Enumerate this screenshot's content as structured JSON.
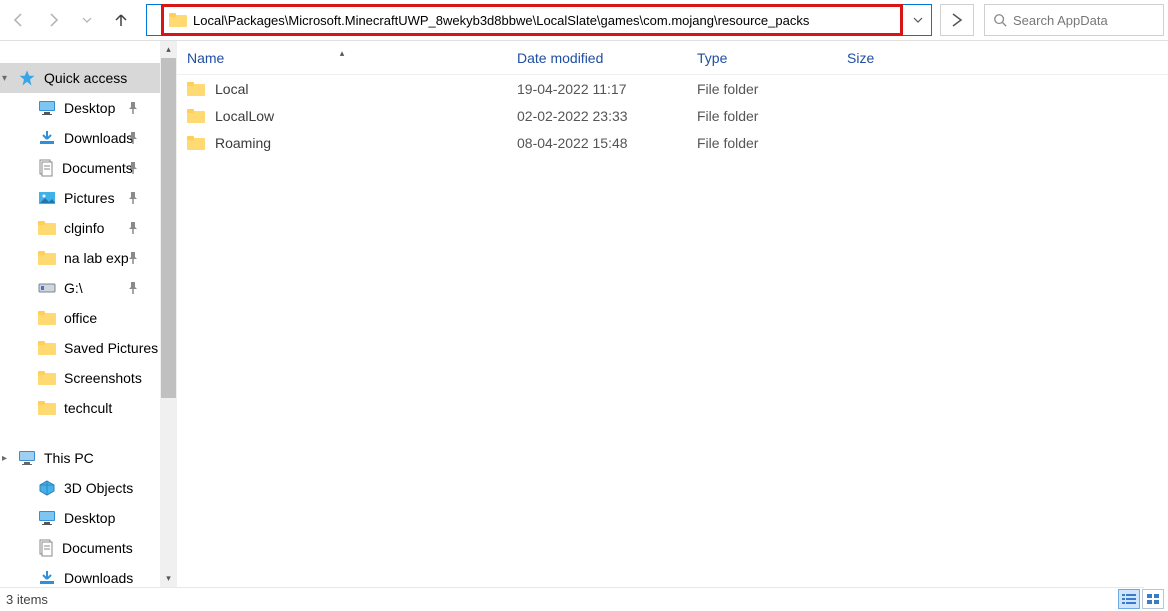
{
  "address_path": "Local\\Packages\\Microsoft.MinecraftUWP_8wekyb3d8bbwe\\LocalSlate\\games\\com.mojang\\resource_packs",
  "search_placeholder": "Search AppData",
  "columns": {
    "name": "Name",
    "date": "Date modified",
    "type": "Type",
    "size": "Size"
  },
  "quick_access_label": "Quick access",
  "quickaccess": [
    {
      "label": "Desktop",
      "icon": "desktop",
      "pinned": true
    },
    {
      "label": "Downloads",
      "icon": "downloads",
      "pinned": true
    },
    {
      "label": "Documents",
      "icon": "documents",
      "pinned": true
    },
    {
      "label": "Pictures",
      "icon": "pictures",
      "pinned": true
    },
    {
      "label": "clginfo",
      "icon": "folder",
      "pinned": true
    },
    {
      "label": "na lab exp",
      "icon": "folder",
      "pinned": true
    },
    {
      "label": "G:\\",
      "icon": "drive-usb",
      "pinned": true
    },
    {
      "label": "office",
      "icon": "folder",
      "pinned": false
    },
    {
      "label": "Saved Pictures",
      "icon": "folder",
      "pinned": false
    },
    {
      "label": "Screenshots",
      "icon": "folder",
      "pinned": false
    },
    {
      "label": "techcult",
      "icon": "folder",
      "pinned": false
    }
  ],
  "this_pc_label": "This PC",
  "thispc": [
    {
      "label": "3D Objects",
      "icon": "3d"
    },
    {
      "label": "Desktop",
      "icon": "desktop"
    },
    {
      "label": "Documents",
      "icon": "documents"
    },
    {
      "label": "Downloads",
      "icon": "downloads"
    }
  ],
  "files": [
    {
      "name": "Local",
      "date": "19-04-2022 11:17",
      "type": "File folder"
    },
    {
      "name": "LocalLow",
      "date": "02-02-2022 23:33",
      "type": "File folder"
    },
    {
      "name": "Roaming",
      "date": "08-04-2022 15:48",
      "type": "File folder"
    }
  ],
  "status_text": "3 items"
}
